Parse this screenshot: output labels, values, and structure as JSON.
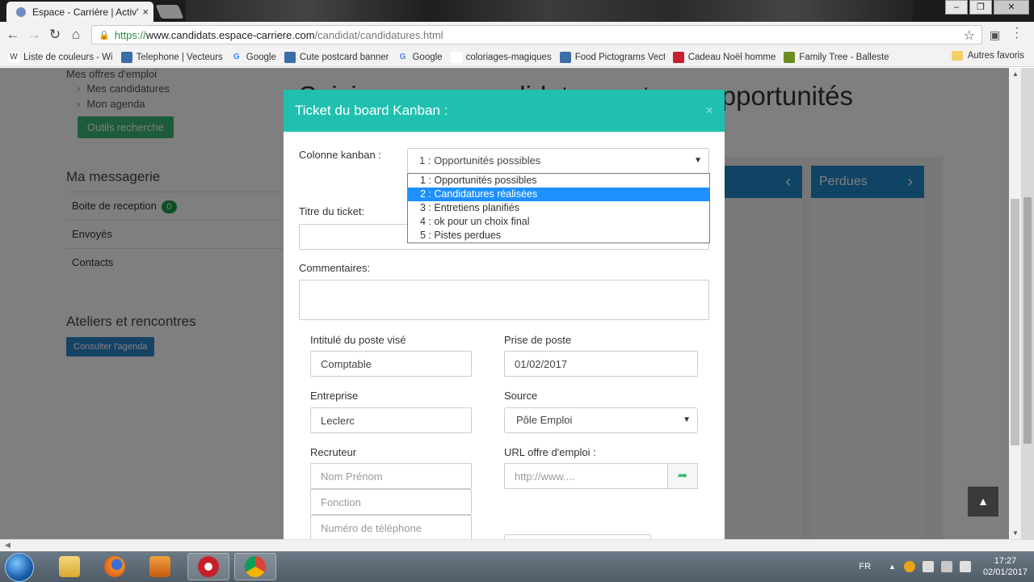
{
  "browser": {
    "tab_title": "Espace - Carrière | Activ'e",
    "tab_close": "×",
    "window_controls": [
      "–",
      "❐",
      "✕"
    ],
    "url_scheme": "https://",
    "url_host": "www.candidats.espace-carriere.com",
    "url_path": "/candidat/candidatures.html",
    "bookmarks": [
      {
        "label": "Liste de couleurs - Wi",
        "icon": "wikipedia-icon",
        "glyph": "W",
        "color": "#ffffff"
      },
      {
        "label": "Telephone | Vecteurs",
        "icon": "freepik-icon",
        "glyph": "",
        "color": "#3b6ea8"
      },
      {
        "label": "Google",
        "icon": "google-icon",
        "glyph": "G",
        "color": "#4285f4"
      },
      {
        "label": "Cute postcard banner",
        "icon": "freepik-icon",
        "glyph": "",
        "color": "#3b6ea8"
      },
      {
        "label": "Google",
        "icon": "google-icon",
        "glyph": "G",
        "color": "#4285f4"
      },
      {
        "label": "coloriages-magiques",
        "icon": "page-icon",
        "glyph": "",
        "color": "#ffffff"
      },
      {
        "label": "Food Pictograms Vect",
        "icon": "freepik-icon",
        "glyph": "",
        "color": "#3b6ea8"
      },
      {
        "label": "Cadeau Noël homme",
        "icon": "gift-icon",
        "glyph": "",
        "color": "#c8202f"
      },
      {
        "label": "Family Tree - Ballester",
        "icon": "geneanet-icon",
        "glyph": "",
        "color": "#6b8e23"
      }
    ],
    "other_bookmarks": "Autres favoris"
  },
  "sidebar": {
    "top_link": "Mes offres d'emploi",
    "links": [
      "Mes candidatures",
      "Mon agenda"
    ],
    "tools_button": "Outils recherche",
    "messaging_title": "Ma messagerie",
    "inbox_label": "Boite de reception",
    "inbox_count": "0",
    "sent_label": "Envoyés",
    "contacts_label": "Contacts",
    "workshops_title": "Ateliers et rencontres",
    "agenda_button": "Consulter l'agenda"
  },
  "main": {
    "title_visible": "Saisissez vos candidatures et vos opportunités",
    "column_lost": "Perdues",
    "scroll_top": "▲"
  },
  "modal": {
    "title": "Ticket du board Kanban :",
    "close": "×",
    "column_label": "Colonne kanban :",
    "column_selected": "1 : Opportunités possibles",
    "column_options": [
      "1 : Opportunités possibles",
      "2 : Candidatures réalisées",
      "3 : Entretiens planifiés",
      "4 : ok pour un choix final",
      "5 : Pistes perdues"
    ],
    "highlighted_option_index": 1,
    "ticket_title_label": "Titre du ticket:",
    "comments_label": "Commentaires:",
    "job_title_label": "Intitulé du poste visé",
    "job_title_value": "Comptable",
    "start_date_label": "Prise de poste",
    "start_date_value": "01/02/2017",
    "company_label": "Entreprise",
    "company_value": "Leclerc",
    "source_label": "Source",
    "source_value": "Pôle Emploi",
    "recruiter_label": "Recruteur",
    "recruiter_name_placeholder": "Nom Prénom",
    "recruiter_role_placeholder": "Fonction",
    "recruiter_phone_placeholder": "Numéro de téléphone",
    "offer_url_label": "URL offre d'emploi :",
    "offer_url_placeholder": "http://www...."
  },
  "taskbar": {
    "language": "FR",
    "time": "17:27",
    "date": "02/01/2017",
    "apps": [
      "explorer-icon",
      "firefox-icon",
      "media-player-icon",
      "recorder-icon",
      "chrome-icon"
    ]
  },
  "colors": {
    "modal_header": "#20c0b0",
    "kanban_header": "#1f88c9",
    "green_button": "#3bb77b",
    "selection": "#1e90ff"
  }
}
